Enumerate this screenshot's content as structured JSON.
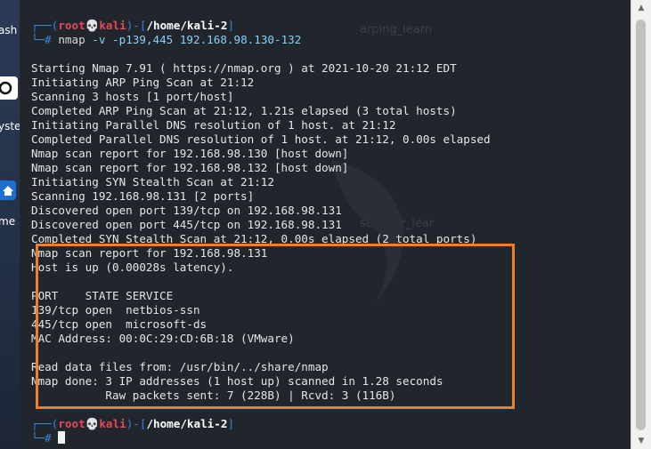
{
  "desktop": {
    "icon_labels": [
      "ash",
      "yste",
      "me"
    ]
  },
  "terminal": {
    "background_labels": [
      "arping_learn",
      "scanner_lear"
    ],
    "prompt1": {
      "open": "┌──(",
      "user": "root💀kali",
      "mid": ")-[",
      "path": "/home/kali-2",
      "close": "]",
      "hash": "└─#",
      "command": "nmap",
      "args": "-v -p139,445 192.168.98.130-132"
    },
    "output": [
      "Starting Nmap 7.91 ( https://nmap.org ) at 2021-10-20 21:12 EDT",
      "Initiating ARP Ping Scan at 21:12",
      "Scanning 3 hosts [1 port/host]",
      "Completed ARP Ping Scan at 21:12, 1.21s elapsed (3 total hosts)",
      "Initiating Parallel DNS resolution of 1 host. at 21:12",
      "Completed Parallel DNS resolution of 1 host. at 21:12, 0.00s elapsed",
      "Nmap scan report for 192.168.98.130 [host down]",
      "Nmap scan report for 192.168.98.132 [host down]",
      "Initiating SYN Stealth Scan at 21:12",
      "Scanning 192.168.98.131 [2 ports]",
      "Discovered open port 139/tcp on 192.168.98.131",
      "Discovered open port 445/tcp on 192.168.98.131",
      "Completed SYN Stealth Scan at 21:12, 0.00s elapsed (2 total ports)",
      "Nmap scan report for 192.168.98.131",
      "Host is up (0.00028s latency).",
      "",
      "PORT    STATE SERVICE",
      "139/tcp open  netbios-ssn",
      "445/tcp open  microsoft-ds",
      "MAC Address: 00:0C:29:CD:6B:18 (VMware)",
      "",
      "Read data files from: /usr/bin/../share/nmap",
      "Nmap done: 3 IP addresses (1 host up) scanned in 1.28 seconds",
      "           Raw packets sent: 7 (228B) | Rcvd: 3 (116B)"
    ],
    "prompt2": {
      "open": "┌──(",
      "user": "root💀kali",
      "mid": ")-[",
      "path": "/home/kali-2",
      "close": "]",
      "hash": "└─#"
    }
  },
  "colors": {
    "highlight_border": "#ef7f2a",
    "prompt_blue": "#3b83d6",
    "prompt_red": "#e8475a"
  }
}
